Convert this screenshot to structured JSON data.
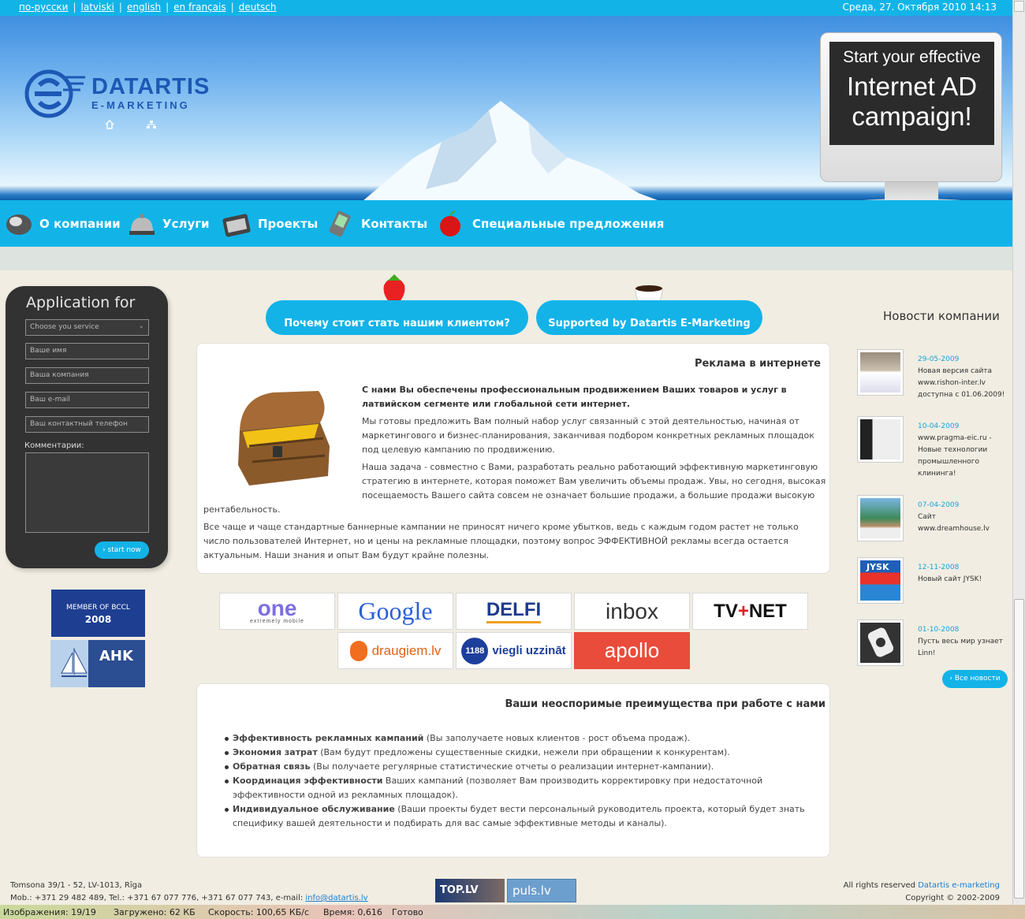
{
  "topbar": {
    "languages": [
      "по-русски",
      "latviski",
      "english",
      "en français",
      "deutsch"
    ],
    "datetime": "Среда, 27. Октября 2010 14:13"
  },
  "logo": {
    "brand": "DATARTIS",
    "sub": "E-MARKETING"
  },
  "monitor": {
    "line1": "Start your effective",
    "line2": "Internet AD campaign!"
  },
  "nav": [
    {
      "label": "О компании",
      "icon": "mouse-icon"
    },
    {
      "label": "Услуги",
      "icon": "bell-icon"
    },
    {
      "label": "Проекты",
      "icon": "case-icon"
    },
    {
      "label": "Контакты",
      "icon": "pda-icon"
    },
    {
      "label": "Специальные предложения",
      "icon": "apple-icon"
    }
  ],
  "form": {
    "title": "Application for",
    "service_placeholder": "Choose you service",
    "name_placeholder": "Ваше имя",
    "company_placeholder": "Ваша компания",
    "email_placeholder": "Ваш e-mail",
    "phone_placeholder": "Ваш контактный телефон",
    "comments_label": "Комментарии:",
    "submit": "› start now"
  },
  "badges": {
    "bccl_line1": "MEMBER OF BCCL",
    "bccl_line2": "2008",
    "ahk": "AHK"
  },
  "tabs": [
    "Почему стоит стать нашим клиентом?",
    "Supported by Datartis E-Marketing"
  ],
  "article": {
    "heading": "Реклама в интернете",
    "lead": "С нами Вы обеспечены профессиональным продвижением Ваших товаров и услуг в латвийском сегменте или глобальной сети интернет.",
    "p1": "Мы готовы предложить Вам полный набор услуг связанный с этой деятельностью, начиная от маркетингового и бизнес-планирования, заканчивая подбором конкретных рекламных площадок под целевую кампанию по продвижению.",
    "p2": "Наша задача - совместно с Вами, разработать реально работающий эффективную маркетинговую стратегию в интернете, которая поможет Вам увеличить объемы продаж. Увы, но сегодня, высокая посещаемость Вашего сайта совсем не означает большие продажи, а большие продажи высокую рентабельность.",
    "p3": "Все чаще и чаще стандартные баннерные кампании не приносят ничего кроме убытков, ведь с каждым годом растет не только число пользователей Интернет, но и цены на рекламные площадки, поэтому вопрос ЭФФЕКТИВНОЙ рекламы всегда остается актуальным. Наши знания и опыт Вам будут крайне полезны."
  },
  "partners": [
    "one",
    "extremely mobile",
    "Google",
    "DELFI",
    "inbox",
    "TV",
    "NET",
    "draugiem.lv",
    "1188",
    "viegli uzzināt",
    "apollo"
  ],
  "benefits": {
    "heading": "Ваши неоспоримые преимущества при работе с нами",
    "items": [
      {
        "bold": "Эффективность рекламных кампаний",
        "rest": " (Вы заполучаете новых клиентов - рост объема продаж)."
      },
      {
        "bold": "Экономия затрат",
        "rest": " (Вам будут предложены существенные скидки, нежели при обращении к конкурентам)."
      },
      {
        "bold": "Обратная связь",
        "rest": " (Вы получаете регулярные статистические отчеты о реализации интернет-кампании)."
      },
      {
        "bold": "Координация эффективности",
        "rest": " Ваших кампаний (позволяет Вам производить корректировку при недостаточной эффективности одной из рекламных площадок)."
      },
      {
        "bold": "Индивидуальное обслуживание",
        "rest": " (Ваши проекты будет вести персональный руководитель проекта, который будет знать специфику вашей деятельности и подбирать для вас самые эффективные методы и каналы)."
      }
    ]
  },
  "news": {
    "title": "Новости компании",
    "items": [
      {
        "date": "29-05-2009",
        "text": "Новая версия сайта www.rishon-inter.lv доступна с 01.06.2009!"
      },
      {
        "date": "10-04-2009",
        "text": "www.pragma-eic.ru - Новые технологии промышленного клининга!"
      },
      {
        "date": "07-04-2009",
        "text": "Сайт www.dreamhouse.lv"
      },
      {
        "date": "12-11-2008",
        "text": "Новый сайт JYSK!"
      },
      {
        "date": "01-10-2008",
        "text": "Пусть весь мир узнает Linn!"
      }
    ],
    "thumb_labels": [
      "JYSK"
    ],
    "all": "› Все новости"
  },
  "footer": {
    "address": "Tomsona 39/1 - 52, LV-1013, Rīga",
    "phones": "Mob.: +371 29 482 489, Tel.: +371 67 077 776, +371 67 077 743, e-mail: ",
    "email": "info@datartis.lv",
    "rights": "All rights reserved ",
    "rights_link": "Datartis e-marketing",
    "copyright": "Copyright © 2002-2009",
    "badge1": "TOP.LV",
    "badge2": "puls.lv"
  },
  "statusbar": {
    "images": "Изображения: 19/19",
    "loaded": "Загружено: 62 КБ",
    "speed": "Скорость: 100,65 КБ/с",
    "time": "Время: 0,616",
    "ready": "Готово"
  },
  "colors": {
    "accent": "#13b3e8",
    "brand": "#1d58b5",
    "dark_panel": "#323232"
  }
}
